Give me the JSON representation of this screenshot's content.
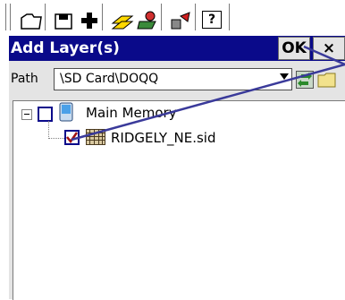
{
  "dialog": {
    "title": "Add Layer(s)",
    "ok_label": "OK",
    "close_label": "×"
  },
  "toolbar": {
    "help_label": "?"
  },
  "path": {
    "label": "Path",
    "value": "\\SD Card\\DOQQ"
  },
  "tree": {
    "root": {
      "label": "Main Memory",
      "expanded": true,
      "checked": false
    },
    "children": [
      {
        "label": "RIDGELY_NE.sid",
        "checked": true
      }
    ]
  },
  "colors": {
    "titlebar": "#0a0a8a",
    "annotation_arrow": "#3a3a9a",
    "checkmark": "#a01010"
  }
}
